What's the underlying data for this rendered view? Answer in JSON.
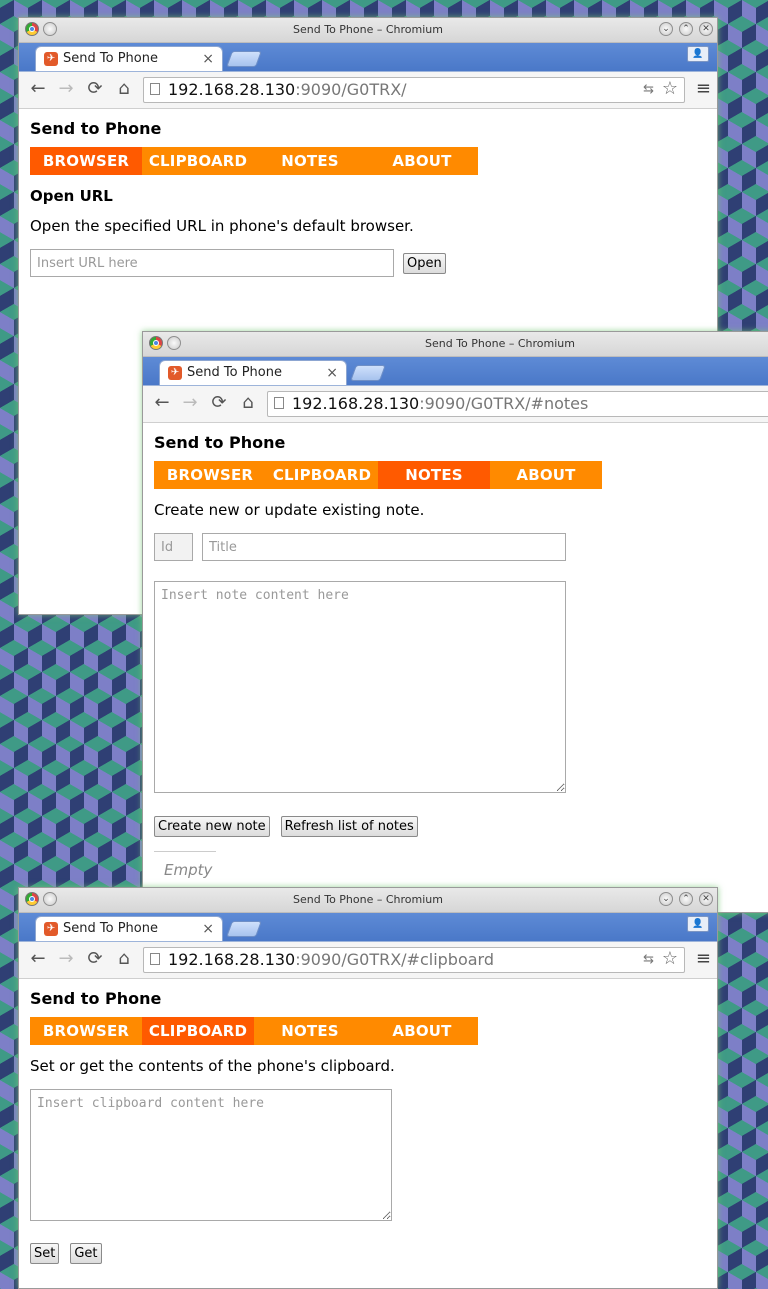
{
  "window_title": "Send To Phone – Chromium",
  "tab_title": "Send To Phone",
  "tab_close": "×",
  "page_title": "Send to Phone",
  "nav_tabs": [
    "BROWSER",
    "CLIPBOARD",
    "NOTES",
    "ABOUT"
  ],
  "icons": {
    "back": "←",
    "forward": "→",
    "reload": "⟳",
    "home": "⌂",
    "star": "☆",
    "menu": "≡",
    "translate": "⇆",
    "min": "⌄",
    "max": "⌃",
    "close": "✕",
    "favicon": "✈",
    "profile": "👤"
  },
  "colors": {
    "tab_orange": "#ff8a00",
    "tab_active": "#ff5a00",
    "tabstrip_blue": "#4a78c8"
  },
  "win1": {
    "url_host": "192.168.28.130",
    "url_path": ":9090/G0TRX/",
    "active_tab": "BROWSER",
    "section_title": "Open URL",
    "description": "Open the specified URL in phone's default browser.",
    "url_placeholder": "Insert URL here",
    "open_button": "Open"
  },
  "win2": {
    "url_host": "192.168.28.130",
    "url_path": ":9090/G0TRX/#notes",
    "active_tab": "NOTES",
    "description": "Create new or update existing note.",
    "id_placeholder": "Id",
    "title_placeholder": "Title",
    "content_placeholder": "Insert note content here",
    "create_button": "Create new note",
    "refresh_button": "Refresh list of notes",
    "empty_text": "Empty"
  },
  "win3": {
    "url_host": "192.168.28.130",
    "url_path": ":9090/G0TRX/#clipboard",
    "active_tab": "CLIPBOARD",
    "description": "Set or get the contents of the phone's clipboard.",
    "content_placeholder": "Insert clipboard content here",
    "set_button": "Set",
    "get_button": "Get"
  }
}
